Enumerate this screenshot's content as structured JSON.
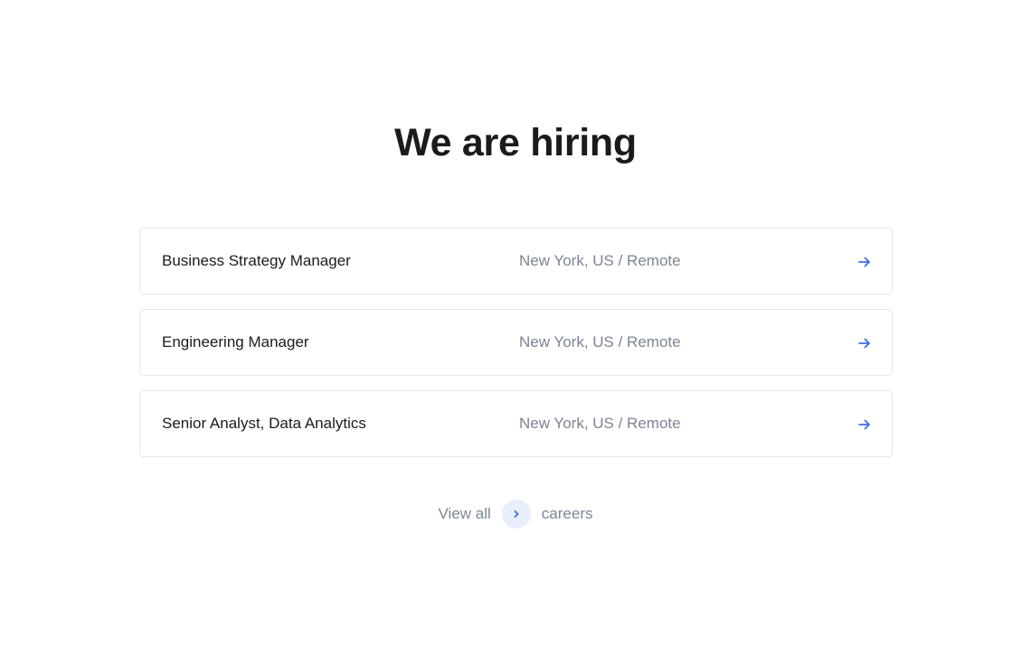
{
  "section": {
    "title": "We are hiring"
  },
  "jobs": [
    {
      "title": "Business Strategy Manager",
      "location": "New York, US / Remote",
      "icon": "arrow-right-icon"
    },
    {
      "title": "Engineering Manager",
      "location": "New York, US / Remote",
      "icon": "arrow-right-icon"
    },
    {
      "title": "Senior Analyst, Data Analytics",
      "location": "New York, US / Remote",
      "icon": "arrow-right-icon"
    }
  ],
  "view_all": {
    "prefix": "View all",
    "suffix": "careers",
    "icon": "chevron-right-icon"
  },
  "colors": {
    "accent": "#3d6fe0",
    "accent_soft_bg": "#e8eefb",
    "heading": "#1b1b1b",
    "muted": "#7b8595",
    "border": "#e6e8ec"
  }
}
